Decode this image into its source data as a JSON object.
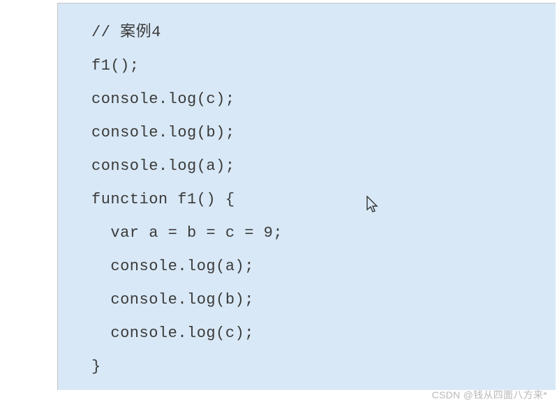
{
  "code": {
    "lines": [
      "// 案例4",
      "f1();",
      "console.log(c);",
      "console.log(b);",
      "console.log(a);",
      "function f1() {",
      "  var a = b = c = 9;",
      "  console.log(a);",
      "  console.log(b);",
      "  console.log(c);",
      "}"
    ]
  },
  "watermark": "CSDN @钱从四面八方来*"
}
